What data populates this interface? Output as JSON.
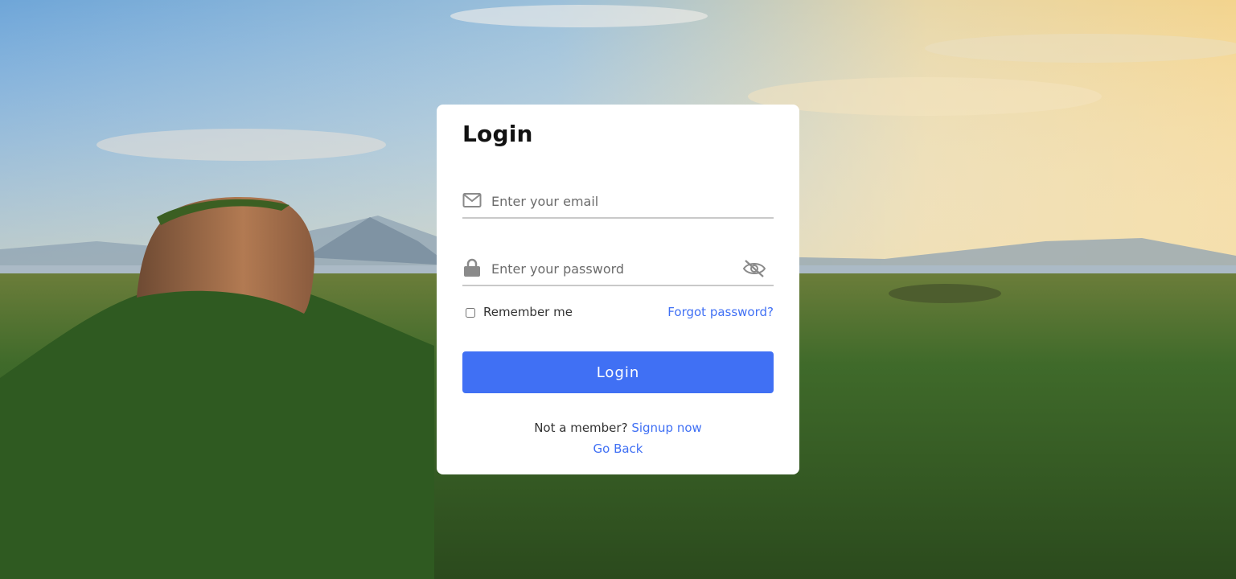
{
  "form": {
    "title": "Login",
    "email": {
      "placeholder": "Enter your email",
      "value": ""
    },
    "password": {
      "placeholder": "Enter your password",
      "value": ""
    },
    "remember_label": "Remember me",
    "remember_checked": false,
    "forgot_label": "Forgot password?",
    "submit_label": "Login",
    "signup_prompt": "Not a member?",
    "signup_link": "Signup now",
    "go_back": "Go Back"
  },
  "icons": {
    "email": "envelope-icon",
    "password": "lock-icon",
    "toggle": "eye-slash-icon"
  },
  "colors": {
    "accent": "#4070f4",
    "card": "#ffffff",
    "underline": "#c9c9c9"
  }
}
